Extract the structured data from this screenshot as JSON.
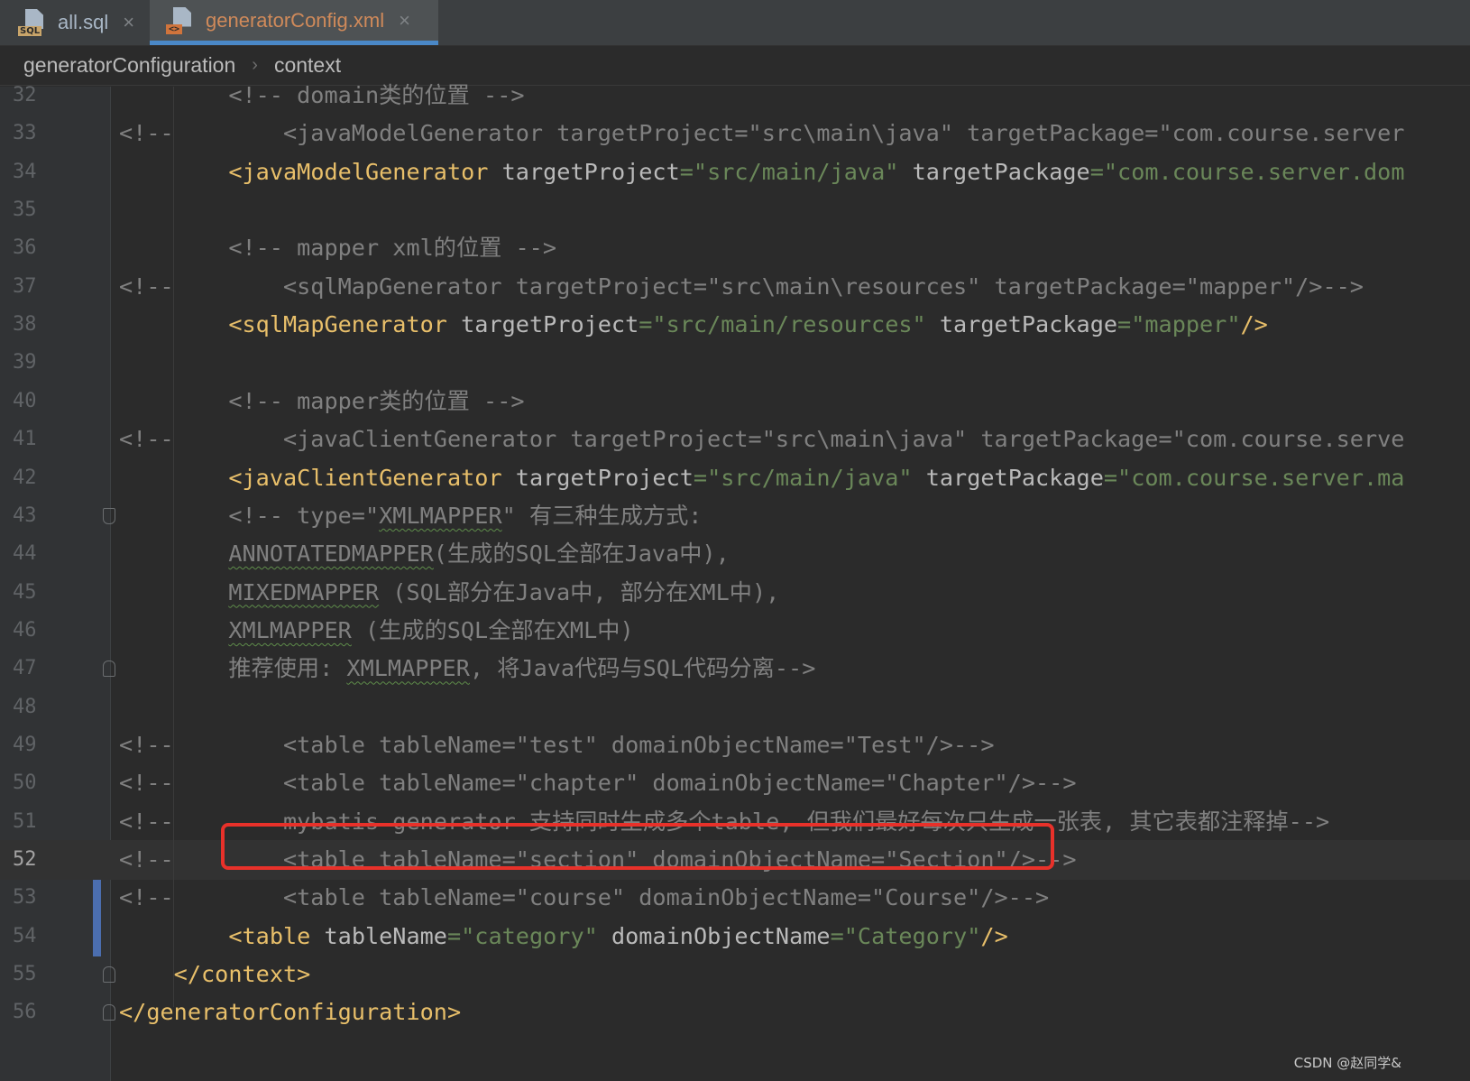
{
  "tabs": [
    {
      "label": "all.sql",
      "icon": "sql-file-icon",
      "badge": "SQL",
      "active": false
    },
    {
      "label": "generatorConfig.xml",
      "icon": "xml-file-icon",
      "badge": "<>",
      "active": true
    }
  ],
  "tab_close_glyph": "×",
  "breadcrumb": [
    "generatorConfiguration",
    "context"
  ],
  "breadcrumb_separator": "›",
  "current_line": 52,
  "lines": [
    {
      "n": "32",
      "segs": [
        [
          "cm",
          "        <!-- domain类的位置 -->"
        ]
      ]
    },
    {
      "n": "33",
      "segs": [
        [
          "cm",
          "<!--        <javaModelGenerator targetProject=\"src\\main\\java\" targetPackage=\"com.course.server"
        ]
      ]
    },
    {
      "n": "34",
      "segs": [
        [
          "",
          "        "
        ],
        [
          "tag",
          "<javaModelGenerator "
        ],
        [
          "attr",
          "targetProject"
        ],
        [
          "val",
          "=\"src/main/java\" "
        ],
        [
          "attr",
          "targetPackage"
        ],
        [
          "val",
          "=\"com.course.server.dom"
        ]
      ]
    },
    {
      "n": "35",
      "segs": []
    },
    {
      "n": "36",
      "segs": [
        [
          "cm",
          "        <!-- mapper xml的位置 -->"
        ]
      ]
    },
    {
      "n": "37",
      "segs": [
        [
          "cm",
          "<!--        <sqlMapGenerator targetProject=\"src\\main\\resources\" targetPackage=\"mapper\"/>-->"
        ]
      ]
    },
    {
      "n": "38",
      "segs": [
        [
          "",
          "        "
        ],
        [
          "tag",
          "<sqlMapGenerator "
        ],
        [
          "attr",
          "targetProject"
        ],
        [
          "val",
          "=\"src/main/resources\" "
        ],
        [
          "attr",
          "targetPackage"
        ],
        [
          "val",
          "=\"mapper\""
        ],
        [
          "tag",
          "/>"
        ]
      ]
    },
    {
      "n": "39",
      "segs": []
    },
    {
      "n": "40",
      "segs": [
        [
          "cm",
          "        <!-- mapper类的位置 -->"
        ]
      ]
    },
    {
      "n": "41",
      "segs": [
        [
          "cm",
          "<!--        <javaClientGenerator targetProject=\"src\\main\\java\" targetPackage=\"com.course.serve"
        ]
      ]
    },
    {
      "n": "42",
      "segs": [
        [
          "",
          "        "
        ],
        [
          "tag",
          "<javaClientGenerator "
        ],
        [
          "attr",
          "targetProject"
        ],
        [
          "val",
          "=\"src/main/java\" "
        ],
        [
          "attr",
          "targetPackage"
        ],
        [
          "val",
          "=\"com.course.server.ma"
        ]
      ]
    },
    {
      "n": "43",
      "segs": [
        [
          "cm",
          "        <!-- type=\""
        ],
        [
          "cm wavy",
          "XMLMAPPER"
        ],
        [
          "cm",
          "\" 有三种生成方式:"
        ]
      ],
      "fold": "down"
    },
    {
      "n": "44",
      "segs": [
        [
          "cm",
          "        "
        ],
        [
          "cm wavy",
          "ANNOTATEDMAPPER"
        ],
        [
          "cm",
          "(生成的SQL全部在Java中),"
        ]
      ]
    },
    {
      "n": "45",
      "segs": [
        [
          "cm",
          "        "
        ],
        [
          "cm wavy",
          "MIXEDMAPPER"
        ],
        [
          "cm",
          " (SQL部分在Java中, 部分在XML中),"
        ]
      ]
    },
    {
      "n": "46",
      "segs": [
        [
          "cm",
          "        "
        ],
        [
          "cm wavy",
          "XMLMAPPER"
        ],
        [
          "cm",
          " (生成的SQL全部在XML中)"
        ]
      ]
    },
    {
      "n": "47",
      "segs": [
        [
          "cm",
          "        推荐使用: "
        ],
        [
          "cm wavy",
          "XMLMAPPER"
        ],
        [
          "cm",
          ", 将Java代码与SQL代码分离-->"
        ]
      ],
      "fold": "up"
    },
    {
      "n": "48",
      "segs": []
    },
    {
      "n": "49",
      "segs": [
        [
          "cm",
          "<!--        <table tableName=\"test\" domainObjectName=\"Test\"/>-->"
        ]
      ]
    },
    {
      "n": "50",
      "segs": [
        [
          "cm",
          "<!--        <table tableName=\"chapter\" domainObjectName=\"Chapter\"/>-->"
        ]
      ]
    },
    {
      "n": "51",
      "segs": [
        [
          "cm",
          "<!--        mybatis generator 支持同时生成多个table, 但我们最好每次只生成一张表, 其它表都注释掉-->"
        ]
      ]
    },
    {
      "n": "52",
      "segs": [
        [
          "cm",
          "<!--        <table tableName=\"section\" domainObjectName=\"Section\"/>-->"
        ]
      ]
    },
    {
      "n": "53",
      "segs": [
        [
          "cm",
          "<!--        <table tableName=\"course\" domainObjectName=\"Course\"/>-->"
        ]
      ]
    },
    {
      "n": "54",
      "segs": [
        [
          "",
          "        "
        ],
        [
          "tag",
          "<table "
        ],
        [
          "attr",
          "tableName"
        ],
        [
          "val",
          "=\"category\" "
        ],
        [
          "attr",
          "domainObjectName"
        ],
        [
          "val",
          "=\"Category\""
        ],
        [
          "tag",
          "/>"
        ]
      ]
    },
    {
      "n": "55",
      "segs": [
        [
          "",
          "    "
        ],
        [
          "tag",
          "</context>"
        ]
      ],
      "fold": "up"
    },
    {
      "n": "56",
      "segs": [
        [
          "tag",
          "</generatorConfiguration>"
        ]
      ],
      "fold": "up"
    }
  ],
  "watermark": "CSDN @赵同学&"
}
